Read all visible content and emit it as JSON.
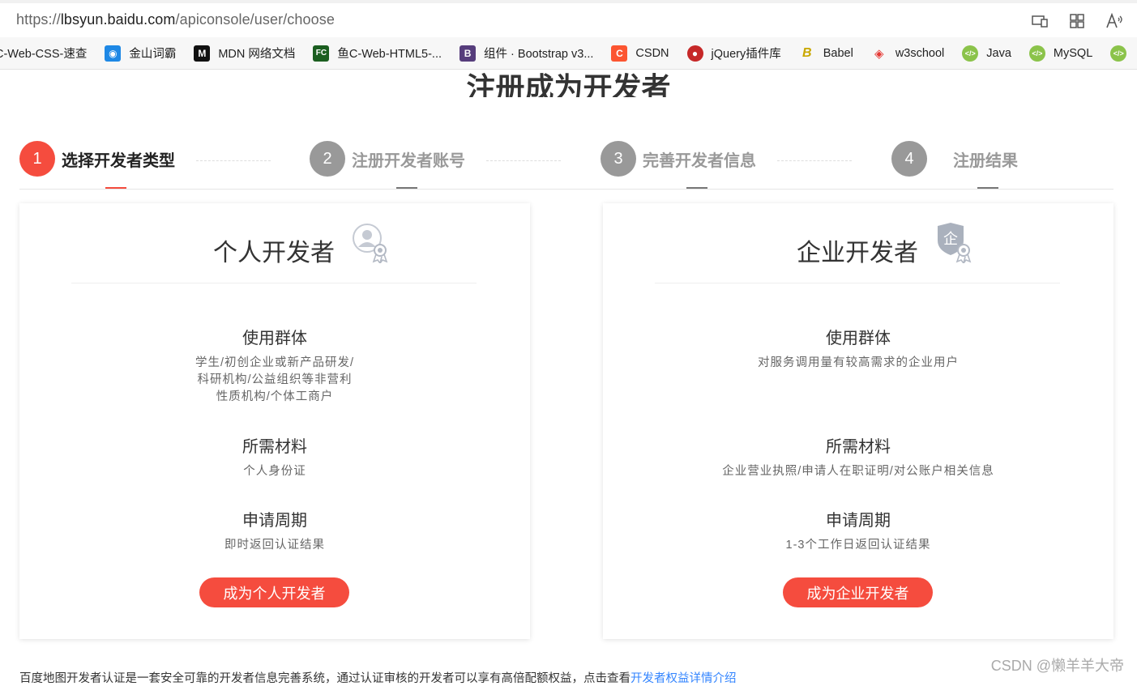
{
  "browser": {
    "url_prefix": "https://",
    "url_host": "lbsyun.baidu.com",
    "url_path": "/apiconsole/user/choose",
    "icons": [
      "device-icon",
      "extensions-icon",
      "read-aloud-icon"
    ]
  },
  "bookmarks": [
    {
      "label": "C-Web-CSS-速查",
      "icon": "",
      "color": ""
    },
    {
      "label": "金山词霸",
      "icon": "ciba-icon",
      "color": "#1e88e5"
    },
    {
      "label": "MDN 网络文档",
      "icon": "mdn-icon",
      "color": "#111111"
    },
    {
      "label": "鱼C-Web-HTML5-...",
      "icon": "fishc-icon",
      "color": "#1b5e20"
    },
    {
      "label": "组件 · Bootstrap v3...",
      "icon": "bootstrap-icon",
      "color": "#563d7c"
    },
    {
      "label": "CSDN",
      "icon": "csdn-icon",
      "color": "#fc5531"
    },
    {
      "label": "jQuery插件库",
      "icon": "jquery-icon",
      "color": "#c62828"
    },
    {
      "label": "Babel",
      "icon": "babel-icon",
      "color": "#f5da55"
    },
    {
      "label": "w3school",
      "icon": "w3school-icon",
      "color": "#e53935"
    },
    {
      "label": "Java",
      "icon": "runoob-icon",
      "color": "#8bc34a"
    },
    {
      "label": "MySQL",
      "icon": "runoob-icon",
      "color": "#8bc34a"
    }
  ],
  "page": {
    "title": "注册成为开发者",
    "accent": "#f54c3e"
  },
  "steps": [
    {
      "num": "1",
      "label": "选择开发者类型",
      "active": true
    },
    {
      "num": "2",
      "label": "注册开发者账号",
      "active": false
    },
    {
      "num": "3",
      "label": "完善开发者信息",
      "active": false
    },
    {
      "num": "4",
      "label": "注册结果",
      "active": false
    }
  ],
  "cards": [
    {
      "title": "个人开发者",
      "badge_icon": "personal-certificate-icon",
      "group_heading": "使用群体",
      "group_lines": [
        "学生/初创企业或新产品研发/",
        "科研机构/公益组织等非营利",
        "性质机构/个体工商户"
      ],
      "material_heading": "所需材料",
      "material_text": "个人身份证",
      "period_heading": "申请周期",
      "period_text": "即时返回认证结果",
      "button": "成为个人开发者"
    },
    {
      "title": "企业开发者",
      "badge_icon": "enterprise-certificate-icon",
      "group_heading": "使用群体",
      "group_lines": [
        "对服务调用量有较高需求的企业用户"
      ],
      "material_heading": "所需材料",
      "material_text": "企业营业执照/申请人在职证明/对公账户相关信息",
      "period_heading": "申请周期",
      "period_text": "1-3个工作日返回认证结果",
      "button": "成为企业开发者"
    }
  ],
  "footer": {
    "text": "百度地图开发者认证是一套安全可靠的开发者信息完善系统，通过认证审核的开发者可以享有高倍配额权益，点击查看",
    "link": "开发者权益详情介绍"
  },
  "watermark": "CSDN @懒羊羊大帝"
}
